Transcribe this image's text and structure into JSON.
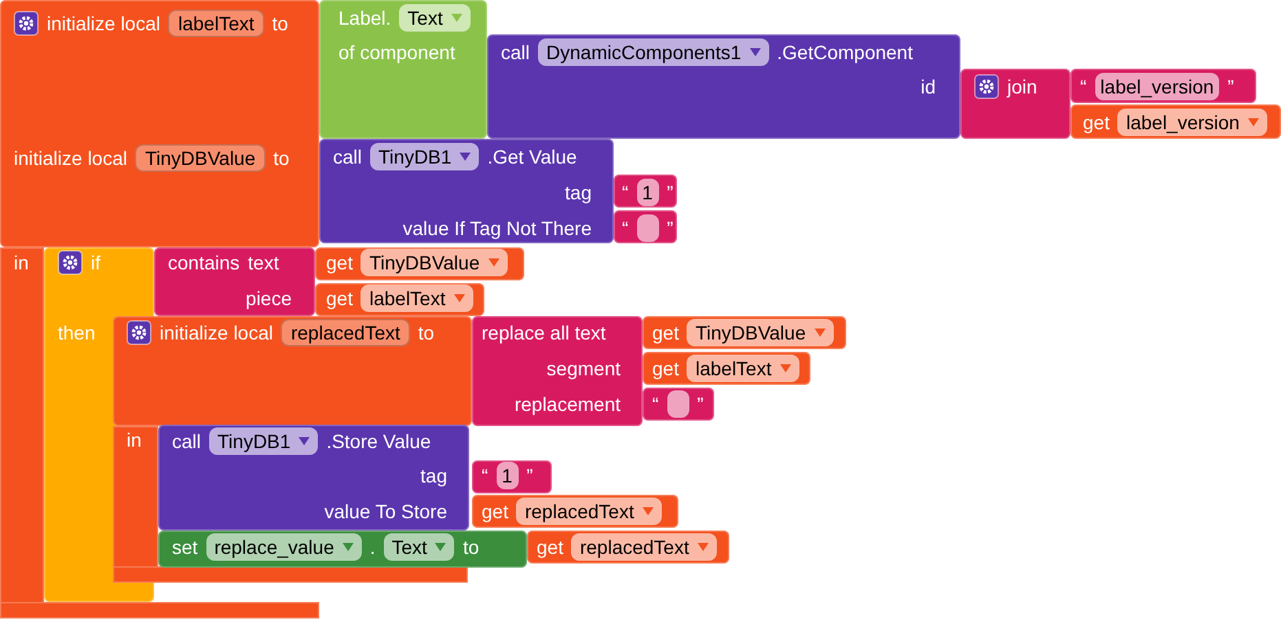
{
  "blocks": [
    {
      "kind": "local-variable",
      "lines": [
        {
          "parts": [
            {
              "kind": "gear"
            },
            {
              "kind": "label",
              "text": "initialize local"
            },
            {
              "kind": "name",
              "text": "labelText"
            },
            {
              "kind": "label",
              "text": "to"
            }
          ]
        },
        {
          "parts": [
            {
              "kind": "label",
              "text": "initialize local"
            },
            {
              "kind": "name",
              "text": "TinyDBValue"
            },
            {
              "kind": "label",
              "text": "to"
            }
          ]
        },
        {
          "parts": [
            {
              "kind": "label",
              "text": "in"
            }
          ]
        }
      ]
    },
    {
      "kind": "component-property",
      "lines": [
        {
          "parts": [
            {
              "kind": "label",
              "text": "Label."
            },
            {
              "kind": "dropdown",
              "text": "Text"
            }
          ]
        },
        {
          "parts": [
            {
              "kind": "label",
              "text": "of component"
            }
          ]
        }
      ]
    },
    {
      "kind": "component-method",
      "lines": [
        {
          "parts": [
            {
              "kind": "label",
              "text": "call"
            },
            {
              "kind": "dropdown",
              "text": "DynamicComponents1"
            },
            {
              "kind": "label",
              "text": ".GetComponent"
            }
          ]
        },
        {
          "parts": [
            {
              "kind": "label",
              "text": "id"
            }
          ]
        }
      ]
    },
    {
      "kind": "text-join",
      "lines": [
        {
          "parts": [
            {
              "kind": "gear"
            },
            {
              "kind": "label",
              "text": "join"
            }
          ]
        }
      ]
    },
    {
      "kind": "text-string",
      "lines": [
        {
          "parts": [
            {
              "kind": "label",
              "text": "“"
            },
            {
              "kind": "text",
              "text": "label_version"
            },
            {
              "kind": "label",
              "text": "”"
            }
          ]
        }
      ]
    },
    {
      "kind": "variable-getter",
      "lines": [
        {
          "parts": [
            {
              "kind": "label",
              "text": "get"
            },
            {
              "kind": "dropdown",
              "text": "label_version"
            }
          ]
        }
      ]
    },
    {
      "kind": "component-method",
      "lines": [
        {
          "parts": [
            {
              "kind": "label",
              "text": "call"
            },
            {
              "kind": "dropdown",
              "text": "TinyDB1"
            },
            {
              "kind": "label",
              "text": ".Get Value"
            }
          ]
        },
        {
          "parts": [
            {
              "kind": "label",
              "text": "tag"
            }
          ]
        },
        {
          "parts": [
            {
              "kind": "label",
              "text": "value If Tag Not There"
            }
          ]
        }
      ]
    },
    {
      "kind": "text-string",
      "lines": [
        {
          "parts": [
            {
              "kind": "label",
              "text": "“"
            },
            {
              "kind": "text",
              "text": "1"
            },
            {
              "kind": "label",
              "text": "”"
            }
          ]
        }
      ]
    },
    {
      "kind": "text-string",
      "lines": [
        {
          "parts": [
            {
              "kind": "label",
              "text": "“"
            },
            {
              "kind": "text"
            },
            {
              "kind": "label",
              "text": "”"
            }
          ]
        }
      ]
    },
    {
      "kind": "control-if",
      "lines": [
        {
          "parts": [
            {
              "kind": "gear"
            },
            {
              "kind": "label",
              "text": "if"
            }
          ]
        },
        {
          "parts": [
            {
              "kind": "label",
              "text": "then"
            }
          ]
        }
      ]
    },
    {
      "kind": "text-contains",
      "lines": [
        {
          "parts": [
            {
              "kind": "label",
              "text": "contains"
            },
            {
              "kind": "label",
              "text": "text"
            }
          ]
        },
        {
          "parts": [
            {
              "kind": "label",
              "text": "piece"
            }
          ]
        }
      ]
    },
    {
      "kind": "variable-getter",
      "lines": [
        {
          "parts": [
            {
              "kind": "label",
              "text": "get"
            },
            {
              "kind": "dropdown",
              "text": "TinyDBValue"
            }
          ]
        }
      ]
    },
    {
      "kind": "variable-getter",
      "lines": [
        {
          "parts": [
            {
              "kind": "label",
              "text": "get"
            },
            {
              "kind": "dropdown",
              "text": "labelText"
            }
          ]
        }
      ]
    },
    {
      "kind": "local-variable",
      "lines": [
        {
          "parts": [
            {
              "kind": "gear"
            },
            {
              "kind": "label",
              "text": "initialize local"
            },
            {
              "kind": "name",
              "text": "replacedText"
            },
            {
              "kind": "label",
              "text": "to"
            }
          ]
        },
        {
          "parts": [
            {
              "kind": "label",
              "text": "in"
            }
          ]
        }
      ]
    },
    {
      "kind": "text-replace",
      "lines": [
        {
          "parts": [
            {
              "kind": "label",
              "text": "replace all text"
            }
          ]
        },
        {
          "parts": [
            {
              "kind": "label",
              "text": "segment"
            }
          ]
        },
        {
          "parts": [
            {
              "kind": "label",
              "text": "replacement"
            }
          ]
        }
      ]
    },
    {
      "kind": "variable-getter",
      "lines": [
        {
          "parts": [
            {
              "kind": "label",
              "text": "get"
            },
            {
              "kind": "dropdown",
              "text": "TinyDBValue"
            }
          ]
        }
      ]
    },
    {
      "kind": "variable-getter",
      "lines": [
        {
          "parts": [
            {
              "kind": "label",
              "text": "get"
            },
            {
              "kind": "dropdown",
              "text": "labelText"
            }
          ]
        }
      ]
    },
    {
      "kind": "text-string",
      "lines": [
        {
          "parts": [
            {
              "kind": "label",
              "text": "“"
            },
            {
              "kind": "text"
            },
            {
              "kind": "label",
              "text": "”"
            }
          ]
        }
      ]
    },
    {
      "kind": "component-method",
      "lines": [
        {
          "parts": [
            {
              "kind": "label",
              "text": "call"
            },
            {
              "kind": "dropdown",
              "text": "TinyDB1"
            },
            {
              "kind": "label",
              "text": ".Store Value"
            }
          ]
        },
        {
          "parts": [
            {
              "kind": "label",
              "text": "tag"
            }
          ]
        },
        {
          "parts": [
            {
              "kind": "label",
              "text": "value To Store"
            }
          ]
        }
      ]
    },
    {
      "kind": "text-string",
      "lines": [
        {
          "parts": [
            {
              "kind": "label",
              "text": "“"
            },
            {
              "kind": "text",
              "text": "1"
            },
            {
              "kind": "label",
              "text": "”"
            }
          ]
        }
      ]
    },
    {
      "kind": "variable-getter",
      "lines": [
        {
          "parts": [
            {
              "kind": "label",
              "text": "get"
            },
            {
              "kind": "dropdown",
              "text": "replacedText"
            }
          ]
        }
      ]
    },
    {
      "kind": "component-setter",
      "lines": [
        {
          "parts": [
            {
              "kind": "label",
              "text": "set"
            },
            {
              "kind": "dropdown",
              "text": "replace_value"
            },
            {
              "kind": "label",
              "text": "."
            },
            {
              "kind": "dropdown",
              "text": "Text"
            },
            {
              "kind": "label",
              "text": "to"
            }
          ]
        }
      ]
    },
    {
      "kind": "variable-getter",
      "lines": [
        {
          "parts": [
            {
              "kind": "label",
              "text": "get"
            },
            {
              "kind": "dropdown",
              "text": "replacedText"
            }
          ]
        }
      ]
    }
  ]
}
